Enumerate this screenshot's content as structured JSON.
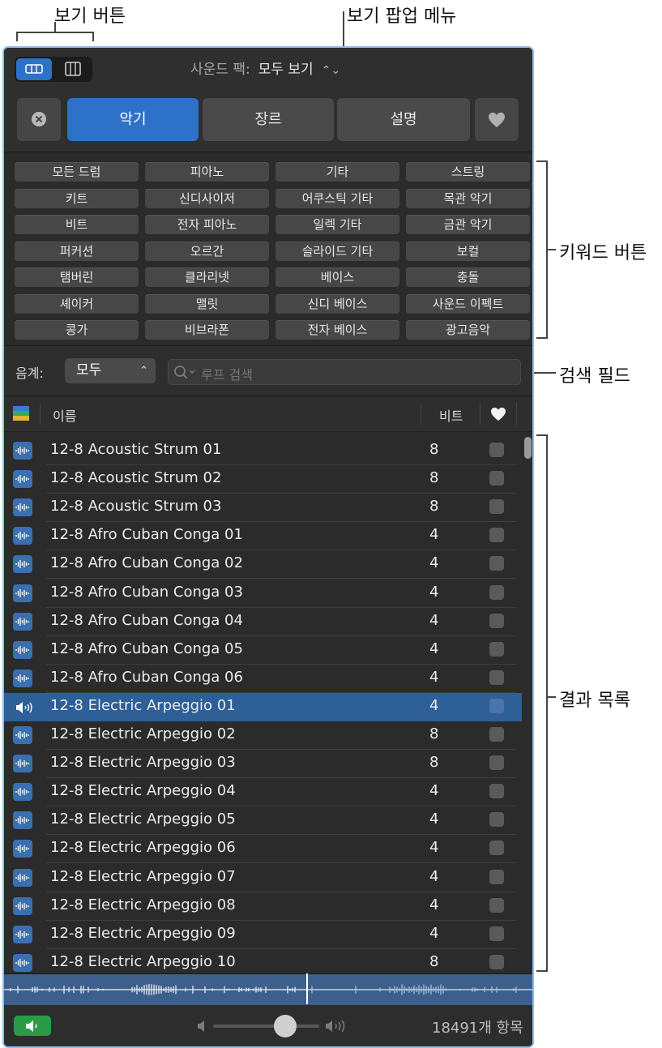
{
  "callouts": {
    "view_buttons": "보기 버튼",
    "view_popup": "보기 팝업 메뉴",
    "keyword_buttons": "키워드 버튼",
    "search_field": "검색 필드",
    "results_list": "결과 목록"
  },
  "header": {
    "sound_pack_label": "사운드 팩:",
    "sound_pack_value": "모두 보기",
    "filters": [
      "악기",
      "장르",
      "설명"
    ],
    "active_filter": "악기"
  },
  "keywords": [
    [
      "모든 드럼",
      "피아노",
      "기타",
      "스트링"
    ],
    [
      "키트",
      "신디사이저",
      "어쿠스틱 기타",
      "목관 악기"
    ],
    [
      "비트",
      "전자 피아노",
      "일렉 기타",
      "금관 악기"
    ],
    [
      "퍼커션",
      "오르간",
      "슬라이드 기타",
      "보컬"
    ],
    [
      "탬버린",
      "클라리넷",
      "베이스",
      "충돌"
    ],
    [
      "셰이커",
      "맬릿",
      "신디 베이스",
      "사운드 이펙트"
    ],
    [
      "콩가",
      "비브라폰",
      "전자 베이스",
      "광고음악"
    ]
  ],
  "search": {
    "scale_label": "음계:",
    "scale_value": "모두",
    "placeholder": "루프 검색"
  },
  "columns": {
    "name": "이름",
    "beats": "비트"
  },
  "results": [
    {
      "name": "12-8 Acoustic Strum 01",
      "beats": "8"
    },
    {
      "name": "12-8 Acoustic Strum 02",
      "beats": "8"
    },
    {
      "name": "12-8 Acoustic Strum 03",
      "beats": "8"
    },
    {
      "name": "12-8 Afro Cuban Conga 01",
      "beats": "4"
    },
    {
      "name": "12-8 Afro Cuban Conga 02",
      "beats": "4"
    },
    {
      "name": "12-8 Afro Cuban Conga 03",
      "beats": "4"
    },
    {
      "name": "12-8 Afro Cuban Conga 04",
      "beats": "4"
    },
    {
      "name": "12-8 Afro Cuban Conga 05",
      "beats": "4"
    },
    {
      "name": "12-8 Afro Cuban Conga 06",
      "beats": "4"
    },
    {
      "name": "12-8 Electric Arpeggio 01",
      "beats": "4",
      "selected": true,
      "playing": true
    },
    {
      "name": "12-8 Electric Arpeggio 02",
      "beats": "8"
    },
    {
      "name": "12-8 Electric Arpeggio 03",
      "beats": "8"
    },
    {
      "name": "12-8 Electric Arpeggio 04",
      "beats": "4"
    },
    {
      "name": "12-8 Electric Arpeggio 05",
      "beats": "4"
    },
    {
      "name": "12-8 Electric Arpeggio 06",
      "beats": "4"
    },
    {
      "name": "12-8 Electric Arpeggio 07",
      "beats": "4"
    },
    {
      "name": "12-8 Electric Arpeggio 08",
      "beats": "4"
    },
    {
      "name": "12-8 Electric Arpeggio 09",
      "beats": "4"
    },
    {
      "name": "12-8 Electric Arpeggio 10",
      "beats": "8"
    }
  ],
  "footer": {
    "item_count": "18491개 항목",
    "volume_fraction": 0.68
  },
  "colors": {
    "accent": "#2d72c8",
    "selection": "#2e5f97",
    "speaker_green": "#2a9b47",
    "panel_bg": "#2b2b2b",
    "outline": "#8ebde9"
  }
}
